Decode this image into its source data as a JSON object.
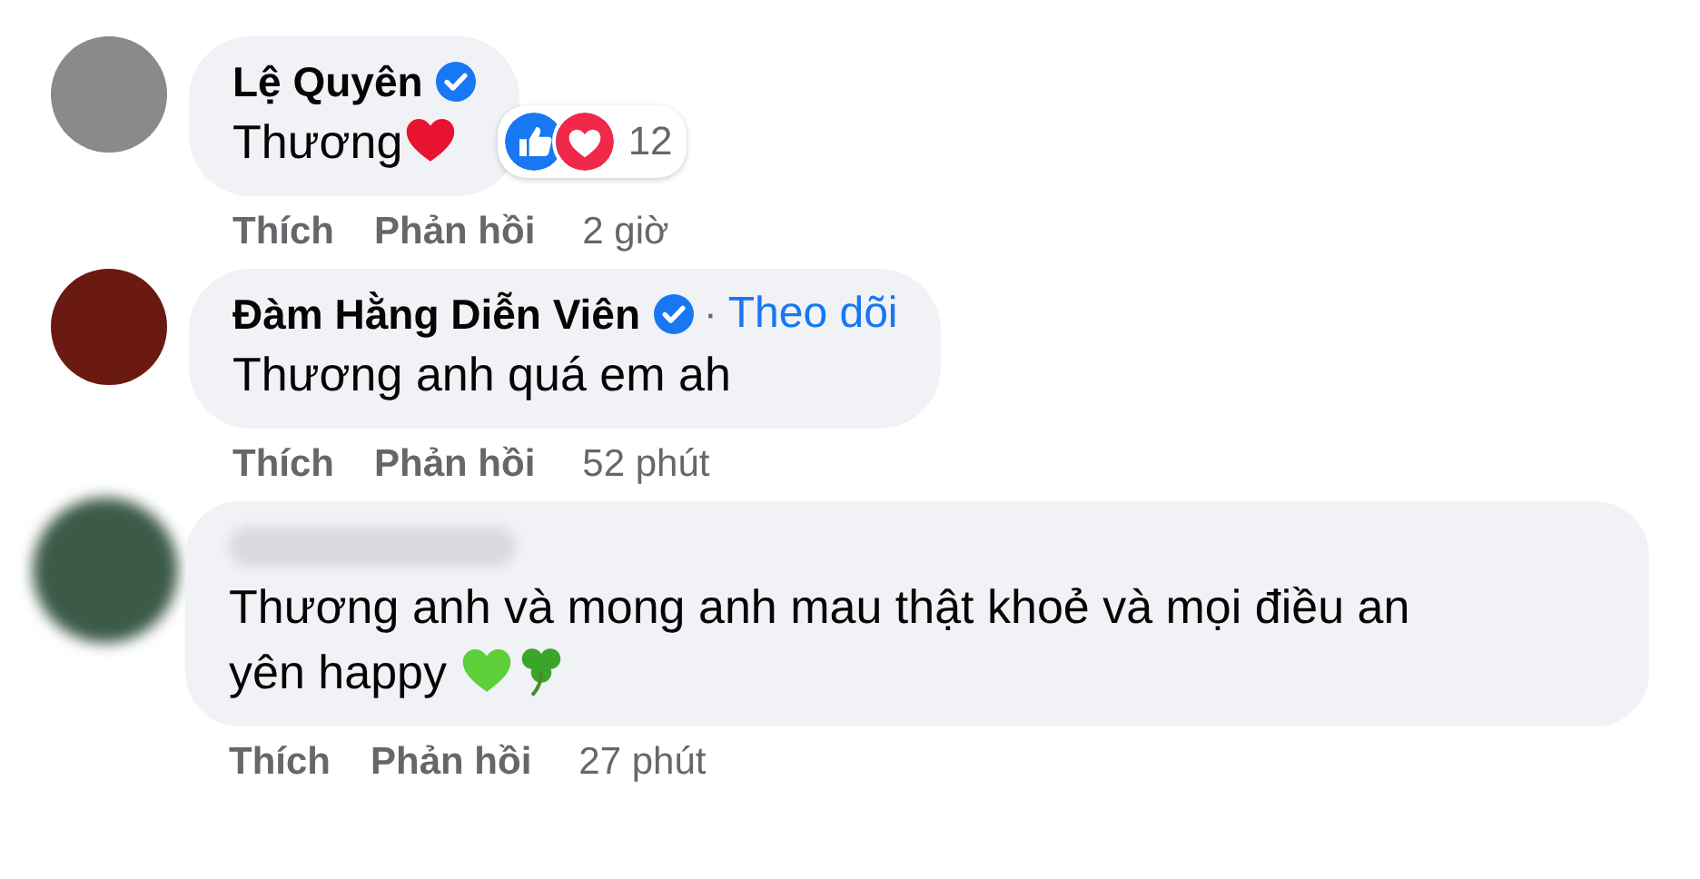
{
  "comments": [
    {
      "name": "Lệ Quyên",
      "verified": true,
      "text": "Thương",
      "trailing_icons": [
        {
          "kind": "heart",
          "color": "#e8132e"
        }
      ],
      "reactions": {
        "count": "12"
      },
      "actions": [
        "Thích",
        "Phản hồi"
      ],
      "time": "2 giờ"
    },
    {
      "name": "Đàm Hằng Diễn Viên",
      "verified": true,
      "separator": "·",
      "follow": "Theo dõi",
      "text": "Thương anh quá em ah",
      "actions": [
        "Thích",
        "Phản hồi"
      ],
      "time": "52 phút"
    },
    {
      "verified": false,
      "text": "Thương anh và mong anh mau thật khoẻ và mọi điều an yên happy ",
      "trailing_icons": [
        {
          "kind": "heart",
          "color": "#5ccf3a"
        },
        {
          "kind": "clover",
          "color": "#3aa52a"
        }
      ],
      "actions": [
        "Thích",
        "Phản hồi"
      ],
      "time": "27 phút"
    }
  ]
}
